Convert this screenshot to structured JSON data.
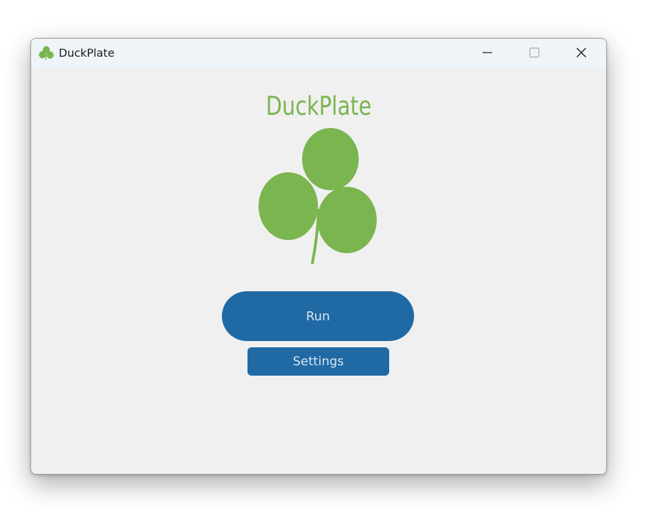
{
  "window": {
    "title": "DuckPlate",
    "app_icon": "clover-icon",
    "controls": {
      "minimize_icon": "minimize-icon",
      "maximize_icon": "maximize-icon",
      "close_icon": "close-icon"
    }
  },
  "main": {
    "logo_text": "DuckPlate",
    "logo_icon": "clover-icon",
    "run_label": "Run",
    "settings_label": "Settings"
  },
  "colors": {
    "brand_green": "#7ab550",
    "button_blue": "#1f6aa5",
    "button_text": "#dce4ee",
    "window_bg": "#f0f0f0",
    "titlebar_bg": "#eff4f9"
  }
}
